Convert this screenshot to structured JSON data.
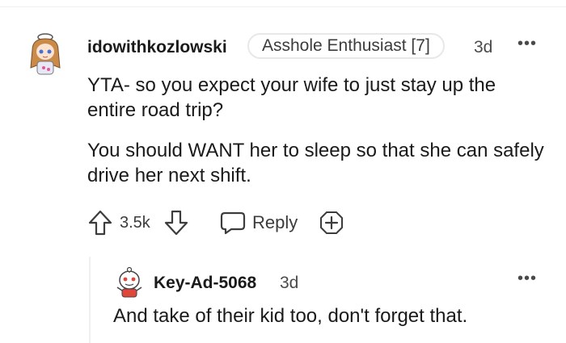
{
  "comment": {
    "author": "idowithkozlowski",
    "flair": "Asshole Enthusiast [7]",
    "age": "3d",
    "more": "•••",
    "paragraphs": [
      "YTA- so you expect your wife to just stay up the entire road trip?",
      "You should WANT her to sleep so that she can safely drive her next shift."
    ],
    "score": "3.5k",
    "reply_label": "Reply"
  },
  "reply": {
    "author": "Key-Ad-5068",
    "age": "3d",
    "more": "•••",
    "text": "And take of their kid too, don't forget that."
  },
  "colors": {
    "text": "#1a1a1b",
    "muted": "#4a4a4a",
    "border": "#e6e8ea"
  },
  "icons": [
    "upvote-icon",
    "downvote-icon",
    "comment-icon",
    "award-icon",
    "more-icon"
  ]
}
